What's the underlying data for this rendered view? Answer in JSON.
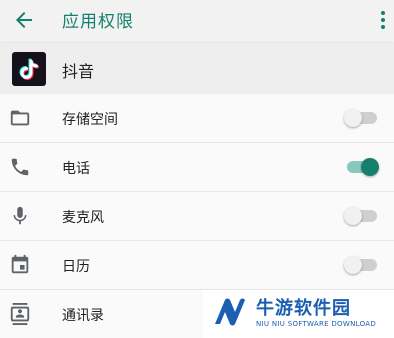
{
  "header": {
    "title": "应用权限",
    "back_icon": "arrow-left-icon",
    "more_icon": "more-vertical-icon"
  },
  "app": {
    "name": "抖音",
    "icon": "tiktok-logo"
  },
  "permissions": [
    {
      "label": "存储空间",
      "icon": "folder-icon",
      "enabled": false
    },
    {
      "label": "电话",
      "icon": "phone-icon",
      "enabled": true
    },
    {
      "label": "麦克风",
      "icon": "microphone-icon",
      "enabled": false
    },
    {
      "label": "日历",
      "icon": "calendar-icon",
      "enabled": false
    },
    {
      "label": "通讯录",
      "icon": "contacts-icon",
      "enabled": null
    }
  ],
  "watermark": {
    "title": "牛游软件园",
    "subtitle": "NIU NIU SOFTWARE DOWNLOAD"
  },
  "colors": {
    "accent": "#14806e",
    "toggle_on_thumb": "#167f6d",
    "toggle_on_track": "#88c8bd",
    "toggle_off_track": "#cfcfcf",
    "watermark_blue": "#1b5fb1"
  }
}
